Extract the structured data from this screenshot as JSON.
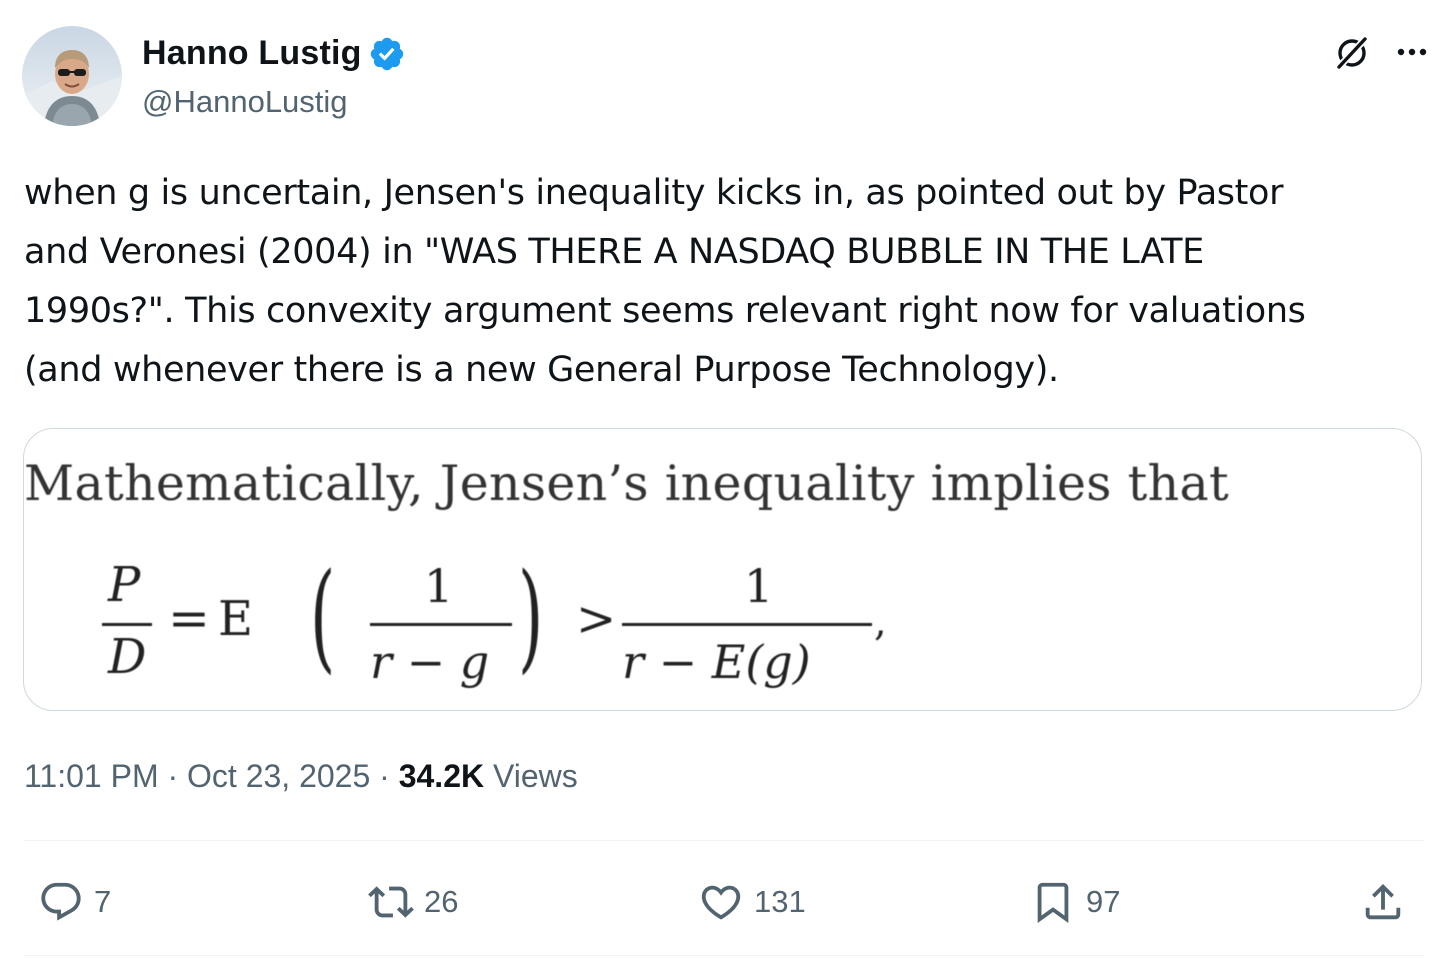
{
  "author": {
    "name": "Hanno Lustig",
    "handle": "@HannoLustig",
    "verified": true,
    "verified_color": "#1d9bf0"
  },
  "icons": {
    "grok": "grok-icon",
    "more": "more-icon"
  },
  "tweet": {
    "lines": [
      "when g is uncertain, Jensen's inequality kicks in, as pointed out by Pastor",
      "and Veronesi (2004) in \"WAS THERE A NASDAQ BUBBLE IN THE LATE",
      "1990s?\". This convexity argument seems relevant right now for valuations",
      "(and whenever there is a new General Purpose Technology)."
    ]
  },
  "media": {
    "caption": "Mathematically, Jensen’s inequality implies that",
    "formula": {
      "lhs_num": "P",
      "lhs_den": "D",
      "eq": "=",
      "expect": "E",
      "paren_open": "(",
      "inner_num": "1",
      "inner_den": "r − g",
      "paren_close": ")",
      "gt": ">",
      "rhs_num": "1",
      "rhs_den": "r − E(g)",
      "comma": ","
    }
  },
  "meta": {
    "time": "11:01 PM",
    "sep1": " · ",
    "date": "Oct 23, 2025",
    "sep2": " · ",
    "views_count": "34.2K",
    "views_label": " Views"
  },
  "actions": {
    "replies": "7",
    "reposts": "26",
    "likes": "131",
    "bookmarks": "97"
  },
  "colors": {
    "text": "#0f1419",
    "secondary": "#536471",
    "border": "#cfd9de",
    "accent": "#1d9bf0"
  }
}
